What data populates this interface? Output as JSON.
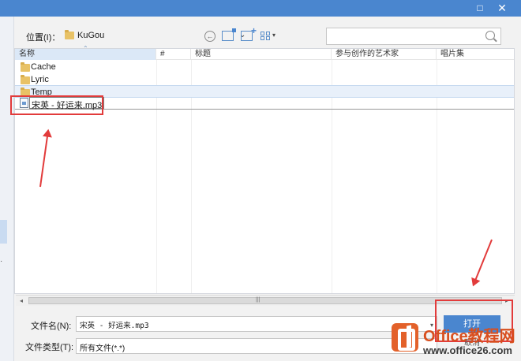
{
  "titlebar": {
    "maximize_label": "□",
    "close_label": "✕"
  },
  "location": {
    "label": "位置(I)：",
    "value": "KuGou",
    "search_placeholder": ""
  },
  "columns": [
    "名称",
    "#",
    "标题",
    "参与创作的艺术家",
    "唱片集"
  ],
  "folders": [
    "Cache",
    "Lyric",
    "Temp"
  ],
  "selected_file": "宋英 - 好运来.mp3",
  "bottom": {
    "filename_label": "文件名(N):",
    "filename_value": "宋英 - 好运来.mp3",
    "filetype_label": "文件类型(T):",
    "filetype_value": "所有文件(*.*)",
    "open_label": "打开",
    "cancel_label": "取消"
  },
  "watermark": {
    "title": "Office教程网",
    "url": "www.office26.com"
  },
  "colors": {
    "accent": "#4a86cf",
    "highlight": "#e23b3b",
    "brand": "#d84f1f"
  },
  "icons": [
    "folder-icon",
    "file-icon",
    "back-icon",
    "up-folder-icon",
    "new-folder-icon",
    "view-icon",
    "search-icon",
    "close-icon",
    "maximize-icon"
  ]
}
